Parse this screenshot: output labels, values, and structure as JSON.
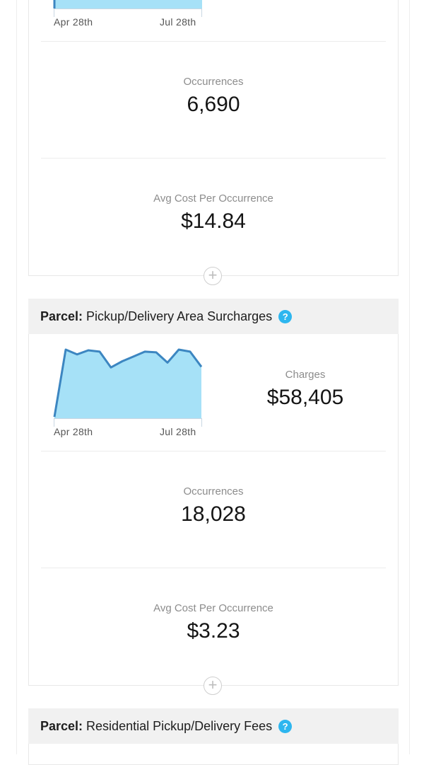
{
  "section1": {
    "chart_data": {
      "type": "area",
      "x_tick_labels": [
        "Apr 28th",
        "Jul 28th"
      ]
    },
    "occurrences": {
      "label": "Occurrences",
      "value": "6,690"
    },
    "avg_cost": {
      "label": "Avg Cost Per Occurrence",
      "value": "$14.84"
    }
  },
  "section2": {
    "header": {
      "prefix": "Parcel:",
      "title": "Pickup/Delivery Area Surcharges",
      "help_icon": "?"
    },
    "chart_data": {
      "type": "area",
      "x_tick_labels": [
        "Apr 28th",
        "Jul 28th"
      ],
      "values": [
        0.02,
        1.0,
        0.93,
        0.99,
        0.97,
        0.74,
        0.83,
        0.9,
        0.97,
        0.96,
        0.81,
        1.0,
        0.97,
        0.75
      ],
      "fill_color": "#a6e1f7",
      "line_color": "#3c86c1"
    },
    "charges": {
      "label": "Charges",
      "value": "$58,405"
    },
    "occurrences": {
      "label": "Occurrences",
      "value": "18,028"
    },
    "avg_cost": {
      "label": "Avg Cost Per Occurrence",
      "value": "$3.23"
    }
  },
  "section3": {
    "header": {
      "prefix": "Parcel:",
      "title": "Residential Pickup/Delivery Fees",
      "help_icon": "?"
    }
  },
  "icons": {
    "expand": "plus-circle-icon",
    "help": "help-icon"
  }
}
